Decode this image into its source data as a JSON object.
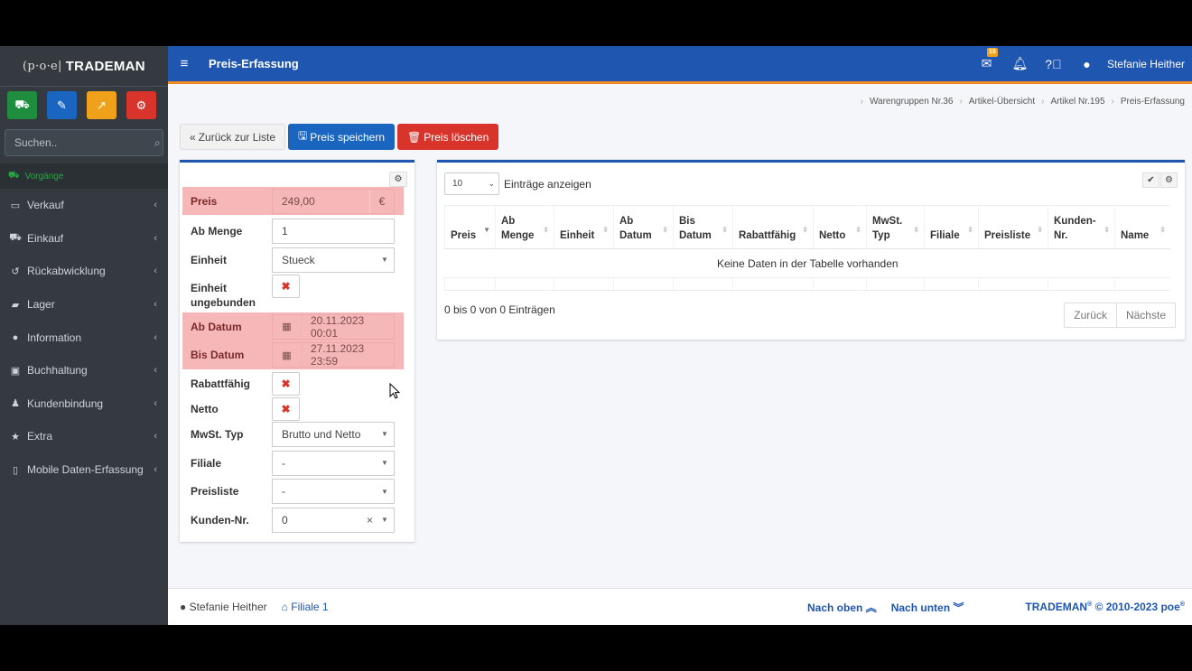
{
  "brand": {
    "poe": "(p·o·e|",
    "name": "TRADEMAN"
  },
  "quick_buttons": [
    {
      "icon": "cart-icon",
      "color": "#1e8e3e",
      "glyph": "🛒"
    },
    {
      "icon": "pencil-icon",
      "color": "#1a65c0",
      "glyph": "✎"
    },
    {
      "icon": "chart-icon",
      "color": "#f0a11b",
      "glyph": "📈"
    },
    {
      "icon": "cogs-icon",
      "color": "#d9342b",
      "glyph": "⚙"
    }
  ],
  "search": {
    "placeholder": "Suchen.."
  },
  "nav_head": "Vorgänge",
  "nav": [
    {
      "label": "Verkauf",
      "icon": "desktop-icon",
      "glyph": "▭"
    },
    {
      "label": "Einkauf",
      "icon": "cart-icon",
      "glyph": "🛒"
    },
    {
      "label": "Rückabwicklung",
      "icon": "undo-icon",
      "glyph": "↺"
    },
    {
      "label": "Lager",
      "icon": "truck-icon",
      "glyph": "⛟"
    },
    {
      "label": "Information",
      "icon": "info-icon",
      "glyph": "ℹ"
    },
    {
      "label": "Buchhaltung",
      "icon": "money-icon",
      "glyph": "▣"
    },
    {
      "label": "Kundenbindung",
      "icon": "users-icon",
      "glyph": "👥"
    },
    {
      "label": "Extra",
      "icon": "star-icon",
      "glyph": "★"
    },
    {
      "label": "Mobile Daten-Erfassung",
      "icon": "mobile-icon",
      "glyph": "▯"
    }
  ],
  "topbar": {
    "title": "Preis-Erfassung",
    "mail_badge": "15",
    "user": "Stefanie Heither"
  },
  "breadcrumb": [
    "Warengruppen Nr.36",
    "Artikel-Übersicht",
    "Artikel Nr.195",
    "Preis-Erfassung"
  ],
  "actions": {
    "back": "Zurück zur Liste",
    "save": "Preis speichern",
    "delete": "Preis löschen"
  },
  "form": {
    "preis": {
      "label": "Preis",
      "value": "249,00",
      "unit": "€"
    },
    "ab_menge": {
      "label": "Ab Menge",
      "value": "1"
    },
    "einheit": {
      "label": "Einheit",
      "value": "Stueck"
    },
    "einheit_ungebunden": {
      "label_1": "Einheit",
      "label_2": "ungebunden"
    },
    "ab_datum": {
      "label": "Ab Datum",
      "value": "20.11.2023 00:01"
    },
    "bis_datum": {
      "label": "Bis Datum",
      "value": "27.11.2023 23:59"
    },
    "rabattfaehig": {
      "label": "Rabattfähig"
    },
    "netto": {
      "label": "Netto"
    },
    "mwst_typ": {
      "label": "MwSt. Typ",
      "value": "Brutto und Netto"
    },
    "filiale": {
      "label": "Filiale",
      "value": "-"
    },
    "preisliste": {
      "label": "Preisliste",
      "value": "-"
    },
    "kunden_nr": {
      "label": "Kunden-Nr.",
      "value": "0"
    }
  },
  "table": {
    "length_value": "10",
    "length_label": "Einträge anzeigen",
    "columns": [
      {
        "l1": "Preis",
        "l2": ""
      },
      {
        "l1": "Ab",
        "l2": "Menge"
      },
      {
        "l1": "Einheit",
        "l2": ""
      },
      {
        "l1": "Ab",
        "l2": "Datum"
      },
      {
        "l1": "Bis",
        "l2": "Datum"
      },
      {
        "l1": "Rabattfähig",
        "l2": ""
      },
      {
        "l1": "Netto",
        "l2": ""
      },
      {
        "l1": "MwSt.",
        "l2": "Typ"
      },
      {
        "l1": "Filiale",
        "l2": ""
      },
      {
        "l1": "Preisliste",
        "l2": ""
      },
      {
        "l1": "Kunden-",
        "l2": "Nr."
      },
      {
        "l1": "Name",
        "l2": ""
      }
    ],
    "empty_text": "Keine Daten in der Tabelle vorhanden",
    "info": "0 bis 0 von 0 Einträgen",
    "prev": "Zurück",
    "next": "Nächste"
  },
  "footer": {
    "user": "Stefanie Heither",
    "filiale": "Filiale 1",
    "nach_oben": "Nach oben",
    "nach_unten": "Nach unten",
    "copyright_brand": "TRADEMAN",
    "copyright_text": " © 2010-2023 poe"
  }
}
